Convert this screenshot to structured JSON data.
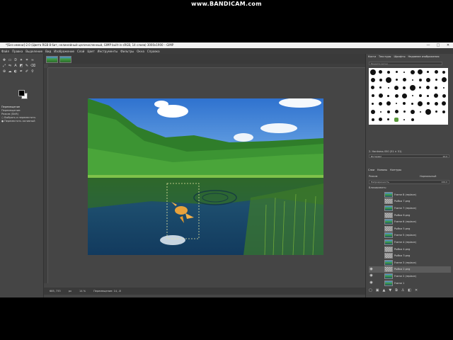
{
  "recorder_watermark": "www.BANDICAM.com",
  "window": {
    "title": "*[Без имени]-2.0 (Цвета RGB 8 бит, нелинейный целочисленный, GIMP built-in sRGB, 14 слоев) 3000x1900 – GIMP",
    "controls": [
      "—",
      "□",
      "✕"
    ]
  },
  "menu": [
    "Файл",
    "Правка",
    "Выделение",
    "Вид",
    "Изображение",
    "Слой",
    "Цвет",
    "Инструменты",
    "Фильтры",
    "Окна",
    "Справка"
  ],
  "toolbox": {
    "tool_icons": [
      "move-icon",
      "rect-select-icon",
      "lasso-icon",
      "fuzzy-select-icon",
      "crop-icon",
      "warp-icon",
      "transform-icon",
      "flip-icon",
      "text-icon",
      "bucket-icon",
      "paintbrush-icon",
      "eraser-icon",
      "clone-icon",
      "smudge-icon",
      "dodge-icon",
      "path-icon",
      "color-picker-icon",
      "zoom-icon"
    ],
    "tool_glyphs": [
      "✥",
      "▭",
      "ᘐ",
      "✦",
      "⌗",
      "≈",
      "⤢",
      "⇋",
      "A",
      "◩",
      "✎",
      "⌫",
      "⊕",
      "☁",
      "◐",
      "✒",
      "✐",
      "⚲"
    ],
    "options": {
      "title": "Перемещение",
      "subtitle": "Перемещение:",
      "mode_label": "Режим (Shift)",
      "option_1": "Выбрать и переместить",
      "option_2": "Переместить активный"
    }
  },
  "status": {
    "coords": "685, 733",
    "unit": "px",
    "zoom": "14 %",
    "message": "Перемещение: 14, -8"
  },
  "dock_top": {
    "tabs": [
      "Кисти",
      "Текстуры",
      "Шрифты",
      "Недавние изображения"
    ],
    "filter_placeholder": "Введите метки",
    "brush_label": "Кисть",
    "brush_name": "2. Hardness 050 (51 × 51)",
    "spacing_label": "Интервал",
    "spacing_value": "10,0"
  },
  "dock_layers": {
    "tabs": [
      "Слои",
      "Каналы",
      "Контуры"
    ],
    "mode_label": "Режим",
    "mode_value": "Нормальный",
    "opacity_label": "Непрозрачность",
    "opacity_value": "100,0",
    "lock_label": "Блокировать:",
    "layers": [
      {
        "name": "Frame 8 (replace)",
        "visible": false,
        "thumb": "photo",
        "active": false
      },
      {
        "name": "Рыбка 7.png",
        "visible": false,
        "thumb": "trans",
        "active": false
      },
      {
        "name": "Frame 7 (replace)",
        "visible": false,
        "thumb": "photo",
        "active": false
      },
      {
        "name": "Рыбка 6.png",
        "visible": false,
        "thumb": "trans",
        "active": false
      },
      {
        "name": "Frame 6 (replace)",
        "visible": false,
        "thumb": "photo",
        "active": false
      },
      {
        "name": "Рыбка 5.png",
        "visible": false,
        "thumb": "trans",
        "active": false
      },
      {
        "name": "Frame 5 (replace)",
        "visible": false,
        "thumb": "photo",
        "active": false
      },
      {
        "name": "Frame 4 (replace)",
        "visible": false,
        "thumb": "photo",
        "active": false
      },
      {
        "name": "Рыбка 4.png",
        "visible": false,
        "thumb": "trans",
        "active": false
      },
      {
        "name": "Рыбка 3.png",
        "visible": false,
        "thumb": "trans",
        "active": false
      },
      {
        "name": "Frame 3 (replace)",
        "visible": false,
        "thumb": "photo",
        "active": false
      },
      {
        "name": "Рыбка 2.png",
        "visible": true,
        "thumb": "trans",
        "active": true
      },
      {
        "name": "Frame 2 (replace)",
        "visible": true,
        "thumb": "photo",
        "active": false
      },
      {
        "name": "Frame 1",
        "visible": true,
        "thumb": "photo",
        "active": false
      }
    ],
    "buttons": [
      "new-layer-icon",
      "layer-group-icon",
      "raise-icon",
      "lower-icon",
      "duplicate-icon",
      "anchor-icon",
      "mask-icon",
      "delete-icon"
    ],
    "button_glyphs": [
      "▢",
      "▣",
      "▲",
      "▼",
      "⧉",
      "⚓",
      "◧",
      "✕"
    ]
  },
  "colors": {
    "ui_dark": "#454545",
    "sky": "#3f86d8",
    "forest": "#2f7d2a",
    "water": "#1d4e6e",
    "fish": "#e8a23c"
  }
}
